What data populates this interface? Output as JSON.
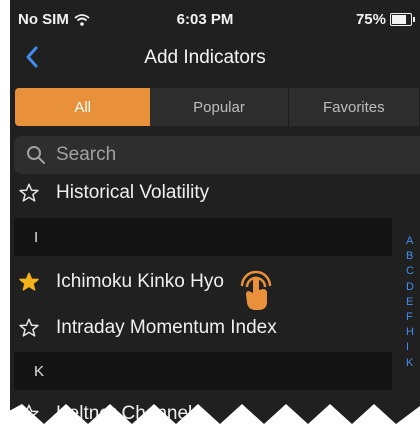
{
  "status_bar": {
    "carrier": "No SIM",
    "time": "6:03 PM",
    "battery": "75%"
  },
  "nav": {
    "title": "Add Indicators"
  },
  "tabs": [
    {
      "label": "All",
      "active": true
    },
    {
      "label": "Popular",
      "active": false
    },
    {
      "label": "Favorites",
      "active": false
    }
  ],
  "search": {
    "placeholder": "Search"
  },
  "list": {
    "row_historical": {
      "label": "Historical Volatility",
      "favorite": false
    },
    "header_i": "I",
    "row_ichimoku": {
      "label": "Ichimoku Kinko Hyo",
      "favorite": true
    },
    "row_intraday": {
      "label": "Intraday Momentum Index",
      "favorite": false
    },
    "header_k": "K",
    "row_keltner": {
      "label": "Keltner Channels",
      "favorite": false
    }
  },
  "index_letters": [
    "A",
    "B",
    "C",
    "D",
    "E",
    "F",
    "H",
    "I",
    "K"
  ],
  "colors": {
    "accent": "#e8913a",
    "star_filled": "#f2b21a",
    "index_blue": "#3f8ef0",
    "background": "#202020"
  },
  "icons": [
    "wifi-icon",
    "battery-icon",
    "back-chevron-icon",
    "search-icon",
    "star-outline-icon",
    "star-filled-icon",
    "tap-gesture-icon"
  ]
}
